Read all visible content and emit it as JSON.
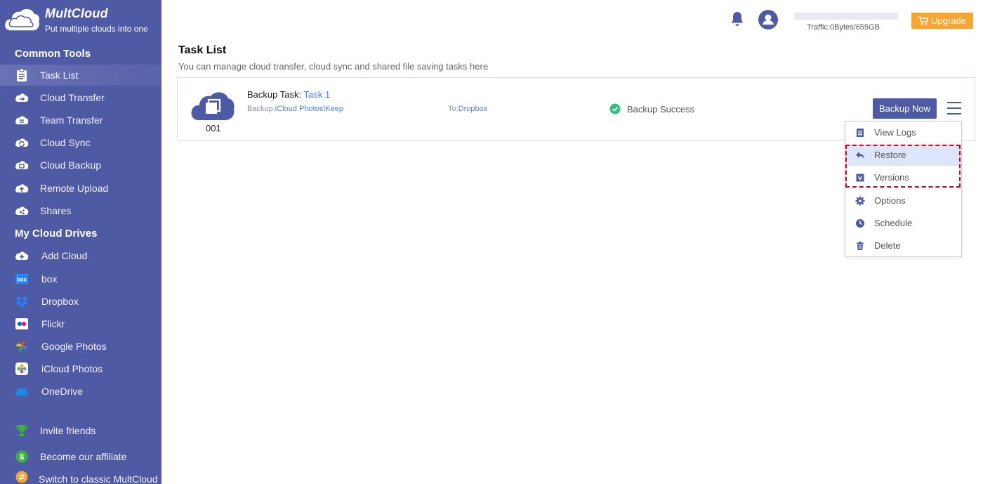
{
  "brand": {
    "name": "MultCloud",
    "tagline": "Put multiple clouds into one"
  },
  "sidebar": {
    "common_tools_title": "Common Tools",
    "common_tools": [
      {
        "label": "Task List",
        "icon": "clipboard-icon",
        "active": true
      },
      {
        "label": "Cloud Transfer",
        "icon": "cloud-transfer-icon"
      },
      {
        "label": "Team Transfer",
        "icon": "team-transfer-icon"
      },
      {
        "label": "Cloud Sync",
        "icon": "cloud-sync-icon"
      },
      {
        "label": "Cloud Backup",
        "icon": "cloud-backup-icon"
      },
      {
        "label": "Remote Upload",
        "icon": "cloud-upload-icon"
      },
      {
        "label": "Shares",
        "icon": "cloud-share-icon"
      }
    ],
    "drives_title": "My Cloud Drives",
    "drives": [
      {
        "label": "Add Cloud",
        "icon": "add-cloud-icon"
      },
      {
        "label": "box",
        "icon": "box-logo-icon"
      },
      {
        "label": "Dropbox",
        "icon": "dropbox-logo-icon"
      },
      {
        "label": "Flickr",
        "icon": "flickr-logo-icon"
      },
      {
        "label": "Google Photos",
        "icon": "google-photos-logo-icon"
      },
      {
        "label": "iCloud Photos",
        "icon": "icloud-photos-logo-icon"
      },
      {
        "label": "OneDrive",
        "icon": "onedrive-logo-icon"
      }
    ],
    "footer": [
      {
        "label": "Invite friends",
        "icon": "trophy-icon"
      },
      {
        "label": "Become our affiliate",
        "icon": "dollar-coin-icon"
      },
      {
        "label": "Switch to classic MultCloud",
        "icon": "switch-icon"
      }
    ]
  },
  "topbar": {
    "traffic": "Traffic:0Bytes/655GB",
    "traffic_used_fraction": 0,
    "upgrade_label": "Upgrade"
  },
  "main": {
    "title": "Task List",
    "subtitle": "You can manage cloud transfer, cloud sync and shared file saving tasks here"
  },
  "task": {
    "number": "001",
    "type_label": "Backup Task:",
    "name": "Task 1",
    "source_prefix": "Backup:",
    "source": "iCloud Photos\\Keep",
    "dest_prefix": "To:",
    "dest": "Dropbox",
    "status": "Backup Success",
    "action_label": "Backup Now"
  },
  "menu": {
    "items": [
      {
        "label": "View Logs",
        "icon": "list-icon"
      },
      {
        "label": "Restore",
        "icon": "reply-icon"
      },
      {
        "label": "Versions",
        "icon": "versions-icon"
      },
      {
        "label": "Options",
        "icon": "gear-icon"
      },
      {
        "label": "Schedule",
        "icon": "clock-icon"
      },
      {
        "label": "Delete",
        "icon": "trash-icon"
      }
    ]
  },
  "colors": {
    "sidebar": "#4f5aa5",
    "accent_link": "#4a7fe0",
    "upgrade": "#f7a636",
    "success": "#2ec27e",
    "highlight": "#d9001b"
  }
}
